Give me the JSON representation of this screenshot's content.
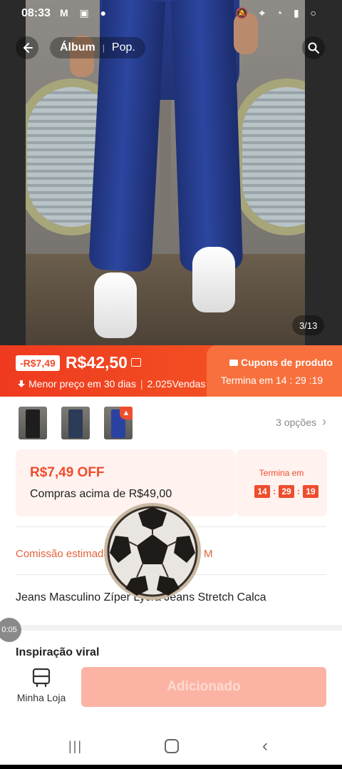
{
  "status_bar": {
    "time": "08:33",
    "left_icons": "M ▣ ●",
    "right_icons": "🔕 ⌖ ◔ ▮ ○"
  },
  "nav": {
    "tabs": [
      {
        "label": "Álbum",
        "active": true
      },
      {
        "label": "Pop.",
        "active": false
      }
    ],
    "image_counter": "3/13"
  },
  "promo": {
    "discount_badge": "-R$7,49",
    "price": "R$42,50",
    "lowest_price_text": "Menor preço em 30 dias",
    "sales": "2.025Vendas",
    "coupon_title": "Cupons de produto",
    "coupon_ends": "Termina em 14 : 29 :19"
  },
  "variants": {
    "options_label": "3 opções"
  },
  "voucher": {
    "amount": "R$7,49 OFF",
    "min_purchase": "Compras acima de R$49,00",
    "timer_label": "Termina em",
    "timer": [
      "14",
      "29",
      "19"
    ]
  },
  "commission": {
    "label": "Comissão estimada",
    "suffix": "M"
  },
  "product": {
    "title": "Jeans Masculino Zíper Lycra Jeans Stretch Calca"
  },
  "section": {
    "title": "Inspiração viral"
  },
  "overlay": {
    "mini_timer": "0:05"
  },
  "actions": {
    "store_label": "Minha Loja",
    "add_label": "Adicionado"
  },
  "colors": {
    "accent": "#ee4d2d",
    "promo_gradient_start": "#ef3a1f",
    "disabled_button": "#fbb4a4"
  },
  "icons": [
    "back-arrow-icon",
    "search-icon",
    "arrow-down-icon",
    "coupon-icon",
    "fire-icon",
    "chevron-right-icon",
    "store-icon",
    "soccer-ball-icon"
  ]
}
